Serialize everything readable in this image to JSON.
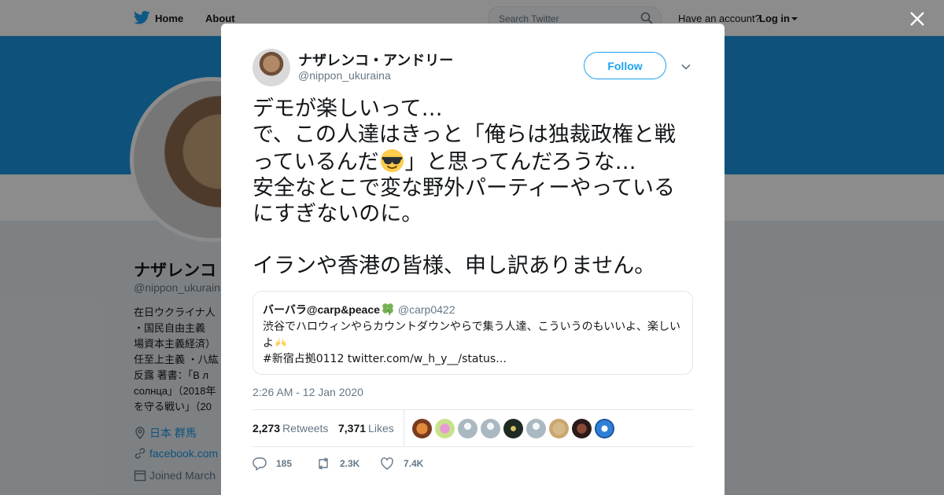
{
  "nav": {
    "home_label": "Home",
    "about_label": "About",
    "search_placeholder": "Search Twitter",
    "have_account": "Have an account?",
    "login_label": "Log in"
  },
  "profile": {
    "name": "ナザレンコ",
    "handle": "@nippon_ukuraina",
    "bio_lines": [
      "在日ウクライナ人",
      "・国民自由主義",
      "場資本主義経済）",
      "任至上主義 ・八紘",
      "反露 著書：「В л",
      "солнца」（2018年",
      "を守る戦い」（20"
    ],
    "location": "日本 群馬",
    "website": "facebook.com",
    "joined": "Joined March"
  },
  "tweet": {
    "author_name": "ナザレンコ・アンドリー",
    "author_handle": "@nippon_ukuraina",
    "follow_label": "Follow",
    "lines": [
      "デモが楽しいって…",
      "で、この人達はきっと「俺らは独裁政権と戦",
      "っているんだ",
      "」と思ってんだろうな…",
      "安全なとこで変な野外パーティーやっている",
      "にすぎないのに。",
      "イランや香港の皆様、申し訳ありません。"
    ],
    "timestamp": "2:26 AM - 12 Jan 2020",
    "retweets_count": "2,273",
    "retweets_label": "Retweets",
    "likes_count": "7,371",
    "likes_label": "Likes",
    "reply_count": "185",
    "retweet_count_short": "2.3K",
    "like_count_short": "7.4K"
  },
  "quote": {
    "name": "バーバラ@carp&peace",
    "handle": "@carp0422",
    "text_line1": "渋谷でハロウィンやらカウントダウンやらで集う人達、こういうのもいいよ、楽しい",
    "text_line2": "よ",
    "text_line3": "#新宿占拠0112 twitter.com/w_h_y__/status…"
  },
  "colors": {
    "accent": "#1da1f2",
    "banner": "#1b95e0",
    "text": "#14171a",
    "muted": "#657786",
    "border": "#e1e8ed"
  },
  "icons": [
    "twitter-bird-icon",
    "search-icon",
    "close-icon",
    "chevron-down-icon",
    "sunglasses-emoji-icon",
    "clover-emoji-icon",
    "raised-hands-emoji-icon",
    "reply-icon",
    "retweet-icon",
    "like-icon",
    "location-icon",
    "link-icon",
    "calendar-icon"
  ]
}
